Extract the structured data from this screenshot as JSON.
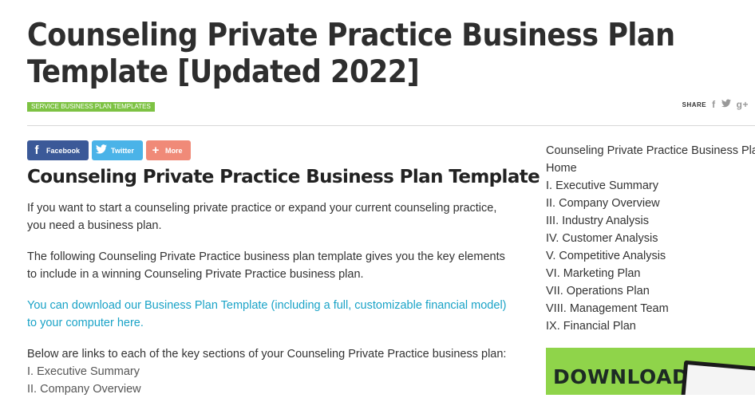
{
  "article": {
    "title": "Counseling Private Practice Business Plan Template [Updated 2022]",
    "category": "SERVICE BUSINESS PLAN TEMPLATES",
    "share_label": "SHARE",
    "social_buttons": {
      "facebook": "Facebook",
      "twitter": "Twitter",
      "more": "More"
    },
    "heading": "Counseling Private Practice Business Plan Template",
    "paragraphs": [
      "If you want to start a counseling private practice or expand your current counseling practice, you need a business plan.",
      "The following Counseling Private Practice business plan template gives you the key elements to include in a winning Counseling Private Practice business plan."
    ],
    "download_link": "You can download our Business Plan Template (including a full, customizable financial model) to your computer here.",
    "links_intro": "Below are links to each of the key sections of your Counseling Private Practice business plan:",
    "toc": [
      "I. Executive Summary",
      "II. Company Overview"
    ]
  },
  "sidebar": {
    "items": [
      "Counseling Private Practice Business Plan Template",
      "Home",
      "I. Executive Summary",
      "II. Company Overview",
      "III. Industry Analysis",
      "IV. Customer Analysis",
      "V. Competitive Analysis",
      "VI. Marketing Plan",
      "VII. Operations Plan",
      "VIII. Management Team",
      "IX. Financial Plan"
    ],
    "promo_text": "DOWNLOAD"
  },
  "colors": {
    "badge": "#7dc243",
    "facebook": "#3b5998",
    "twitter": "#4ab3e8",
    "more": "#f08a78",
    "link": "#1aa3c7",
    "promo": "#8fd44a"
  },
  "icons": {
    "facebook": "facebook-icon",
    "twitter": "twitter-icon",
    "more": "plus-icon",
    "google_plus": "google-plus-icon"
  }
}
